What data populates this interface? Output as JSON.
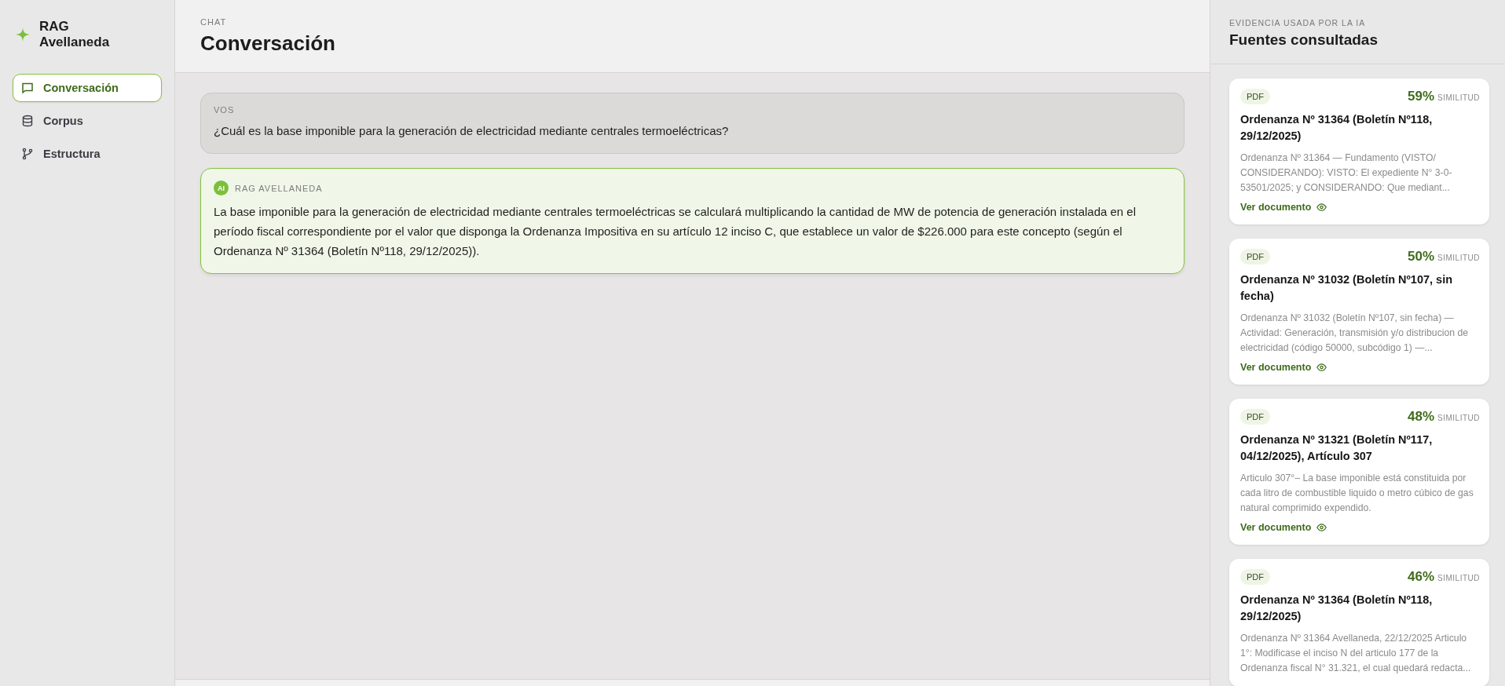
{
  "brand": {
    "name": "RAG Avellaneda"
  },
  "sidebar": {
    "items": [
      {
        "label": "Conversación",
        "kind": "chat",
        "selected": true
      },
      {
        "label": "Corpus",
        "kind": "database",
        "selected": false
      },
      {
        "label": "Estructura",
        "kind": "branch",
        "selected": false
      }
    ]
  },
  "header": {
    "eyebrow": "CHAT",
    "title": "Conversación"
  },
  "messages": [
    {
      "kind": "user",
      "author": "VOS",
      "text": "¿Cuál es la base imponible para la generación de electricidad mediante centrales termoeléctricas?"
    },
    {
      "kind": "assistant",
      "avatar": "AI",
      "author": "RAG AVELLANEDA",
      "text": "La base imponible para la generación de electricidad mediante centrales termoeléctricas se calculará multiplicando la cantidad de MW de potencia de generación instalada en el período fiscal correspondiente por el valor que disponga la Ordenanza Impositiva en su artículo 12 inciso C, que establece un valor de $226.000 para este concepto (según el Ordenanza Nº 31364 (Boletín Nº118, 29/12/2025))."
    }
  ],
  "sources_panel": {
    "eyebrow": "EVIDENCIA USADA POR LA IA",
    "title": "Fuentes consultadas",
    "sources": [
      {
        "type": "PDF",
        "score": "59%",
        "score_label": "SIMILITUD",
        "title": "Ordenanza Nº 31364 (Boletín Nº118, 29/12/2025)",
        "excerpt": "Ordenanza Nº 31364 — Fundamento (VISTO/ CONSIDERANDO): VISTO: El expediente N° 3-0-53501/2025; y CONSIDERANDO: Que mediant...",
        "link": "Ver documento"
      },
      {
        "type": "PDF",
        "score": "50%",
        "score_label": "SIMILITUD",
        "title": "Ordenanza Nº 31032 (Boletín Nº107, sin fecha)",
        "excerpt": "Ordenanza Nº 31032 (Boletín Nº107, sin fecha) — Actividad: Generación, transmisión y/o distribucion de electricidad (código 50000, subcódigo 1) —...",
        "link": "Ver documento"
      },
      {
        "type": "PDF",
        "score": "48%",
        "score_label": "SIMILITUD",
        "title": "Ordenanza Nº 31321 (Boletín Nº117, 04/12/2025), Artículo 307",
        "excerpt": "Articulo 307°– La base imponible está constituida por cada litro de combustible liquido o metro cúbico de gas natural comprimido expendido.",
        "link": "Ver documento"
      },
      {
        "type": "PDF",
        "score": "46%",
        "score_label": "SIMILITUD",
        "title": "Ordenanza Nº 31364 (Boletín Nº118, 29/12/2025)",
        "excerpt": "Ordenanza Nº 31364 Avellaneda, 22/12/2025 Articulo 1°: Modificase el inciso N del articulo 177 de la Ordenanza fiscal N° 31.321, el cual quedará redacta..."
      }
    ]
  }
}
